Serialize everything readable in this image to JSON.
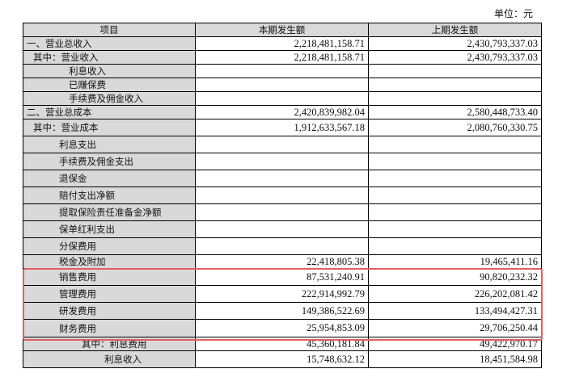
{
  "unit_label": "单位：元",
  "headers": [
    "项目",
    "本期发生额",
    "上期发生额"
  ],
  "rows": [
    {
      "label": "一、营业总收入",
      "current": "2,218,481,158.71",
      "prior": "2,430,793,337.03"
    },
    {
      "label": "其中：营业收入",
      "current": "2,218,481,158.71",
      "prior": "2,430,793,337.03"
    },
    {
      "label": "利息收入",
      "current": "",
      "prior": ""
    },
    {
      "label": "已赚保费",
      "current": "",
      "prior": ""
    },
    {
      "label": "手续费及佣金收入",
      "current": "",
      "prior": ""
    },
    {
      "label": "二、营业总成本",
      "current": "2,420,839,982.04",
      "prior": "2,580,448,733.40"
    },
    {
      "label": "其中：营业成本",
      "current": "1,912,633,567.18",
      "prior": "2,080,760,330.75"
    },
    {
      "label": "利息支出",
      "current": "",
      "prior": ""
    },
    {
      "label": "手续费及佣金支出",
      "current": "",
      "prior": ""
    },
    {
      "label": "退保金",
      "current": "",
      "prior": ""
    },
    {
      "label": "赔付支出净额",
      "current": "",
      "prior": ""
    },
    {
      "label": "提取保险责任准备金净额",
      "current": "",
      "prior": ""
    },
    {
      "label": "保单红利支出",
      "current": "",
      "prior": ""
    },
    {
      "label": "分保费用",
      "current": "",
      "prior": ""
    },
    {
      "label": "税金及附加",
      "current": "22,418,805.38",
      "prior": "19,465,411.16"
    },
    {
      "label": "销售费用",
      "current": "87,531,240.91",
      "prior": "90,820,232.32"
    },
    {
      "label": "管理费用",
      "current": "222,914,992.79",
      "prior": "226,202,081.42"
    },
    {
      "label": "研发费用",
      "current": "149,386,522.69",
      "prior": "133,494,427.31"
    },
    {
      "label": "财务费用",
      "current": "25,954,853.09",
      "prior": "29,706,250.44"
    },
    {
      "label": "其中：利息费用",
      "current": "45,360,181.84",
      "prior": "49,422,970.17"
    },
    {
      "label": "利息收入",
      "current": "15,748,632.12",
      "prior": "18,451,584.98"
    }
  ]
}
